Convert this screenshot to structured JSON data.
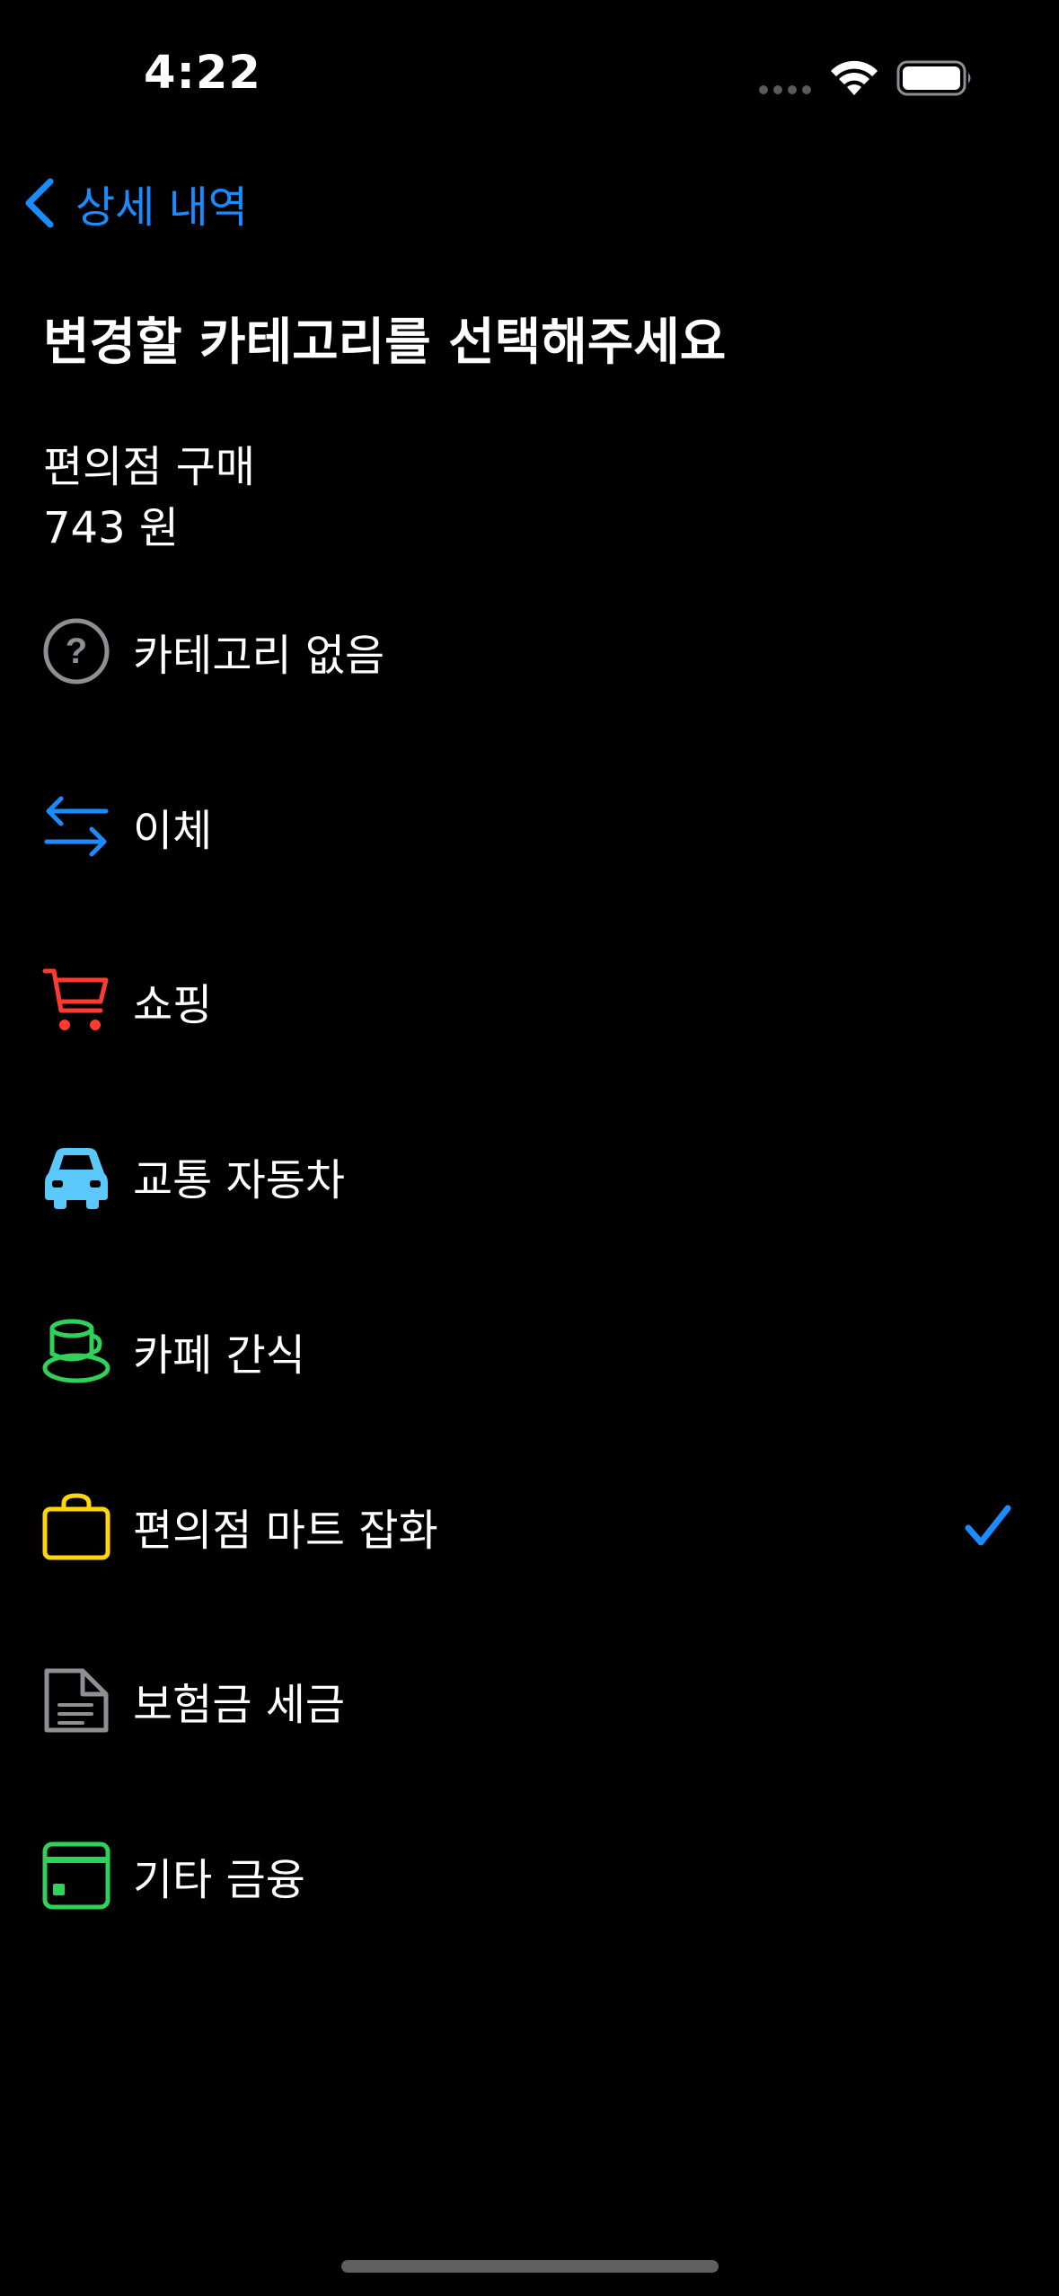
{
  "status_bar": {
    "time": "4:22"
  },
  "nav": {
    "back_label": "상세 내역"
  },
  "page": {
    "title": "변경할 카테고리를 선택해주세요",
    "transaction_name": "편의점 구매",
    "transaction_amount": "743 원"
  },
  "categories": [
    {
      "label": "카테고리 없음",
      "icon": "question-circle-icon",
      "color": "#8e8e93"
    },
    {
      "label": "이체",
      "icon": "transfer-arrows-icon",
      "color": "#1a8cff"
    },
    {
      "label": "쇼핑",
      "icon": "shopping-cart-icon",
      "color": "#ff3b30"
    },
    {
      "label": "교통 자동차",
      "icon": "car-icon",
      "color": "#5ac8fa"
    },
    {
      "label": "카페 간식",
      "icon": "coffee-cup-icon",
      "color": "#30d158"
    },
    {
      "label": "편의점 마트 잡화",
      "icon": "shopping-bag-icon",
      "color": "#ffd60a",
      "selected": true
    },
    {
      "label": "보험금 세금",
      "icon": "document-icon",
      "color": "#8e8e93"
    },
    {
      "label": "기타 금융",
      "icon": "card-icon",
      "color": "#30d158"
    }
  ],
  "colors": {
    "accent": "#1a8cff",
    "background": "#000000",
    "text": "#ffffff"
  }
}
